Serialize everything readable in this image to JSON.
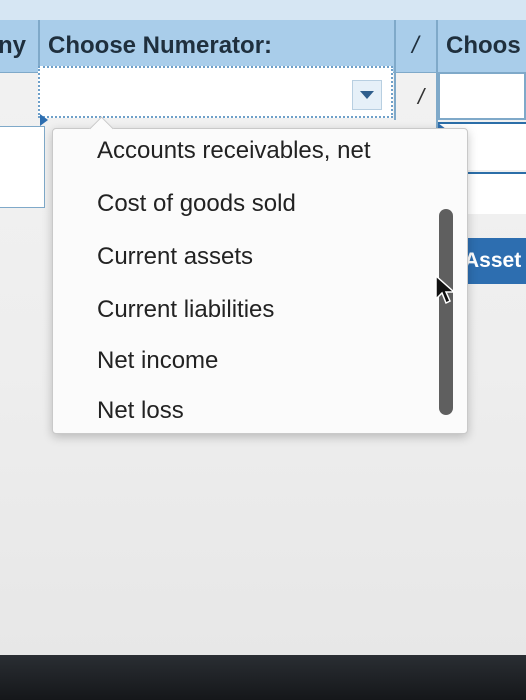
{
  "header": {
    "left_fragment": "ny",
    "numerator_label": "Choose Numerator:",
    "divider_symbol": "/",
    "right_fragment": "Choos"
  },
  "numerator_row": {
    "selected_value": "",
    "divider_symbol": "/"
  },
  "side_badge": {
    "label": "Asset"
  },
  "dropdown": {
    "options": [
      "Accounts receivables, net",
      "Cost of goods sold",
      "Current assets",
      "Current liabilities",
      "Net income",
      "Net loss"
    ]
  },
  "colors": {
    "header_bg": "#a9cdea",
    "accent": "#2d6eb0",
    "dropdown_bg": "#fbfbfb"
  },
  "icons": {
    "dropdown_arrow": "chevron-down-icon",
    "cursor": "mouse-pointer-icon"
  }
}
